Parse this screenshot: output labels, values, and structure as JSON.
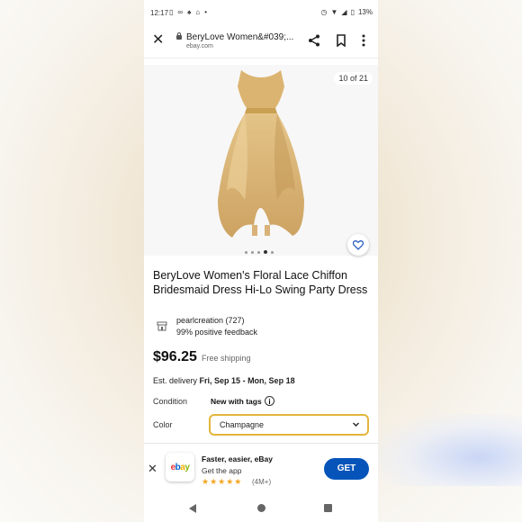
{
  "status_bar": {
    "time": "12:17",
    "battery": "13%"
  },
  "browser": {
    "title": "BeryLove Women&#039;...",
    "domain": "ebay.com"
  },
  "gallery": {
    "counter": "10 of 21",
    "dots": 5,
    "active_dot": 3
  },
  "product": {
    "title": "BeryLove Women's Floral Lace Chiffon Bridesmaid Dress Hi-Lo Swing Party Dress",
    "seller_name": "pearlcreation (727)",
    "seller_feedback": "99% positive feedback",
    "price": "$96.25",
    "shipping": "Free shipping",
    "delivery_prefix": "Est. delivery",
    "delivery_dates": "Fri, Sep 15 - Mon, Sep 18",
    "condition_label": "Condition",
    "condition_value": "New with tags",
    "color_label": "Color",
    "color_value": "Champagne"
  },
  "app_promo": {
    "logo": "ebay",
    "title": "Faster, easier, eBay",
    "subtitle": "Get the app",
    "stars": "★★★★★",
    "rating_count": "(4M+)",
    "cta": "GET"
  },
  "colors": {
    "accent_blue": "#0654ba",
    "select_border": "#e2b53b",
    "dress": "#d9b370"
  },
  "icons": [
    "close-icon",
    "lock-icon",
    "share-icon",
    "bookmark-icon",
    "more-vert-icon",
    "heart-icon",
    "store-icon",
    "info-icon",
    "chevron-down-icon",
    "star-icon",
    "back-nav-icon",
    "home-nav-icon",
    "recents-nav-icon"
  ]
}
